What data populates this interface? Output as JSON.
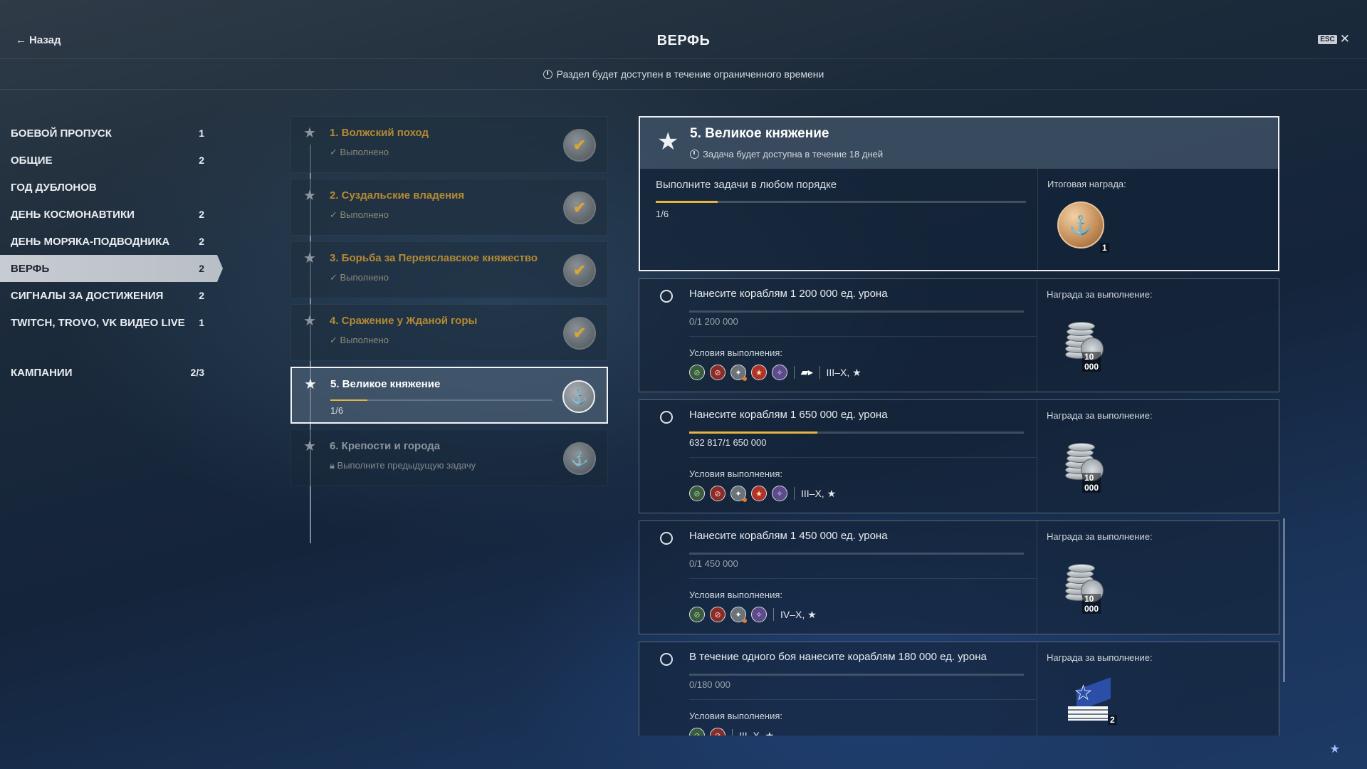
{
  "header": {
    "back_label": "Назад",
    "title": "ВЕРФЬ",
    "esc_label": "ESC",
    "notice": "Раздел будет доступен в течение ограниченного времени"
  },
  "sidebar": {
    "items": [
      {
        "label": "БОЕВОЙ ПРОПУСК",
        "count": "1",
        "active": false
      },
      {
        "label": "ОБЩИЕ",
        "count": "2",
        "active": false
      },
      {
        "label": "ГОД ДУБЛОНОВ",
        "count": "",
        "active": false
      },
      {
        "label": "ДЕНЬ КОСМОНАВТИКИ",
        "count": "2",
        "active": false
      },
      {
        "label": "ДЕНЬ МОРЯКА-ПОДВОДНИКА",
        "count": "2",
        "active": false
      },
      {
        "label": "ВЕРФЬ",
        "count": "2",
        "active": true
      },
      {
        "label": "СИГНАЛЫ ЗА ДОСТИЖЕНИЯ",
        "count": "2",
        "active": false
      },
      {
        "label": "TWITCH, TROVO, VK ВИДЕО LIVE",
        "count": "1",
        "active": false
      }
    ],
    "campaigns": {
      "label": "КАМПАНИИ",
      "count": "2/3"
    }
  },
  "chain": {
    "tasks": [
      {
        "title": "1. Волжский поход",
        "status": "Выполнено",
        "state": "done"
      },
      {
        "title": "2. Суздальские владения",
        "status": "Выполнено",
        "state": "done"
      },
      {
        "title": "3. Борьба за Переяславское княжество",
        "status": "Выполнено",
        "state": "done"
      },
      {
        "title": "4. Сражение у Жданой горы",
        "status": "Выполнено",
        "state": "done"
      },
      {
        "title": "5. Великое княжение",
        "progress": "1/6",
        "progress_fraction": 0.1667,
        "state": "active"
      },
      {
        "title": "6. Крепости и города",
        "status": "Выполните предыдущую задачу",
        "state": "locked"
      }
    ]
  },
  "detail": {
    "title": "5. Великое княжение",
    "subtitle": "Задача будет доступна в течение 18 дней",
    "instruction": "Выполните задачи в любом порядке",
    "progress": "1/6",
    "progress_fraction": 0.1667,
    "final_reward_label": "Итоговая награда:",
    "final_reward_count": "1",
    "conditions_label": "Условия выполнения:",
    "reward_label": "Награда за выполнение:",
    "subtasks": [
      {
        "title": "Нанесите кораблям 1 200 000 ед. урона",
        "progress": "0/1 200 000",
        "progress_fraction": 0,
        "tier": "III–X, ★",
        "reward": "10 000",
        "reward_icon": "credits-icon"
      },
      {
        "title": "Нанесите кораблям 1 650 000 ед. урона",
        "progress": "632 817/1 650 000",
        "progress_fraction": 0.3835,
        "tier": "III–X, ★",
        "reward": "10 000",
        "reward_icon": "credits-icon"
      },
      {
        "title": "Нанесите кораблям 1 450 000 ед. урона",
        "progress": "0/1 450 000",
        "progress_fraction": 0,
        "tier": "IV–X, ★",
        "reward": "10 000",
        "reward_icon": "credits-icon"
      },
      {
        "title": "В течение одного боя нанесите кораблям 180 000 ед. урона",
        "progress": "0/180 000",
        "progress_fraction": 0,
        "tier": "III–X, ★",
        "reward": "2",
        "reward_icon": "signal-flag-icon"
      }
    ]
  },
  "colors": {
    "accent": "#e7b53f",
    "done_title": "#b58a32",
    "active_bg": "#c7ccd2"
  }
}
